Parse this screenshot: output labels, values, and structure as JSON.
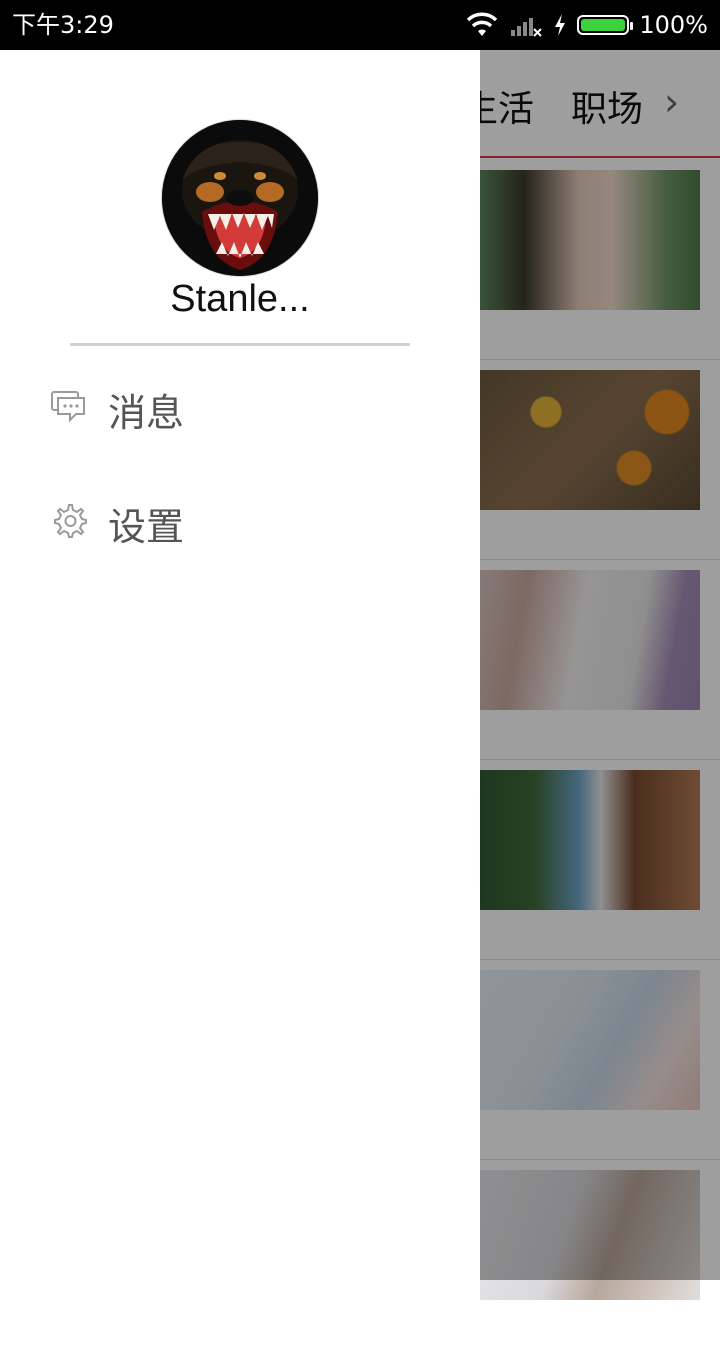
{
  "status_bar": {
    "time": "下午3:29",
    "battery": "100%",
    "icons": [
      "wifi-icon",
      "signal-icon",
      "charging-icon",
      "battery-icon"
    ]
  },
  "background": {
    "tabs": [
      "生活",
      "职场"
    ],
    "more_icon": "chevron-right-icon"
  },
  "drawer": {
    "username": "Stanle...",
    "avatar_icon": "dog-avatar",
    "menu": [
      {
        "label": "消息",
        "icon": "chat-icon"
      },
      {
        "label": "设置",
        "icon": "gear-icon"
      }
    ]
  },
  "colors": {
    "tab_underline": "#d63a3a",
    "scrim": "rgba(0,0,0,0.38)"
  }
}
